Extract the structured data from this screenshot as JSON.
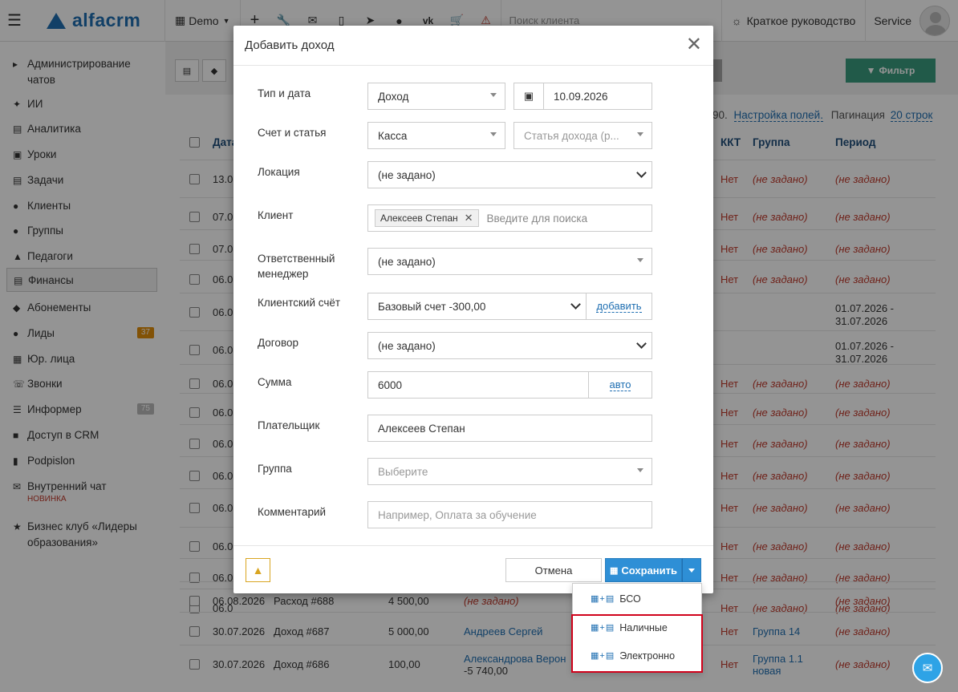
{
  "topbar": {
    "logo": "alfacrm",
    "demo": "Demo",
    "search_placeholder": "Поиск клиента",
    "guide": "Краткое руководство",
    "user": "Service"
  },
  "sidebar": {
    "items": [
      {
        "label": "Администрирование чатов",
        "icon": "chat-admin-icon"
      },
      {
        "label": "ИИ",
        "icon": "sparkles-icon"
      },
      {
        "label": "Аналитика",
        "icon": "chart-icon"
      },
      {
        "label": "Уроки",
        "icon": "calendar-icon"
      },
      {
        "label": "Задачи",
        "icon": "clipboard-icon"
      },
      {
        "label": "Клиенты",
        "icon": "user-icon"
      },
      {
        "label": "Группы",
        "icon": "users-icon"
      },
      {
        "label": "Педагоги",
        "icon": "graduation-cap-icon"
      },
      {
        "label": "Финансы",
        "icon": "money-icon"
      },
      {
        "label": "Абонементы",
        "icon": "tag-icon"
      },
      {
        "label": "Лиды",
        "icon": "user-plus-icon",
        "badge": "37"
      },
      {
        "label": "Юр. лица",
        "icon": "building-icon"
      },
      {
        "label": "Звонки",
        "icon": "phone-icon"
      },
      {
        "label": "Информер",
        "icon": "list-icon",
        "badge": "75"
      },
      {
        "label": "Доступ в CRM",
        "icon": "lock-icon"
      },
      {
        "label": "Podpislon",
        "icon": "document-icon"
      },
      {
        "label": "Внутренний чат",
        "icon": "envelope-icon",
        "note": "НОВИНКА"
      },
      {
        "label": "Бизнес клуб «Лидеры образования»",
        "icon": "star-icon"
      }
    ]
  },
  "main": {
    "filter_label": "Фильтр",
    "pagination_prefix": "90.",
    "settings_link": "Настройка полей.",
    "pagination_label": "Пагинация",
    "pagination_value": "20 строк",
    "columns": {
      "date": "Дата",
      "kkt": "ККТ",
      "group": "Группа",
      "period": "Период"
    },
    "rows": [
      {
        "date": "13.0",
        "kkt": "Нет",
        "group": "(не задано)",
        "period": "(не задано)"
      },
      {
        "date": "07.0",
        "kkt": "Нет",
        "group": "(не задано)",
        "period": "(не задано)"
      },
      {
        "date": "07.0",
        "kkt": "Нет",
        "group": "(не задано)",
        "period": "(не задано)"
      },
      {
        "date": "06.0",
        "kkt": "Нет",
        "group": "(не задано)",
        "period": "(не задано)"
      },
      {
        "date": "06.0",
        "kkt": "",
        "group": "",
        "period": "01.07.2026 - 31.07.2026"
      },
      {
        "date": "06.0",
        "kkt": "",
        "group": "",
        "period": "01.07.2026 - 31.07.2026"
      },
      {
        "date": "06.0",
        "kkt": "Нет",
        "group": "(не задано)",
        "period": "(не задано)"
      },
      {
        "date": "06.0",
        "kkt": "Нет",
        "group": "(не задано)",
        "period": "(не задано)"
      },
      {
        "date": "06.0",
        "kkt": "Нет",
        "group": "(не задано)",
        "period": "(не задано)"
      },
      {
        "date": "06.0",
        "kkt": "Нет",
        "group": "(не задано)",
        "period": "(не задано)"
      },
      {
        "date": "06.0",
        "kkt": "Нет",
        "group": "(не задано)",
        "period": "(не задано)"
      },
      {
        "date": "06.0",
        "kkt": "Нет",
        "group": "(не задано)",
        "period": "(не задано)"
      },
      {
        "date": "06.0",
        "kkt": "Нет",
        "group": "(не задано)",
        "period": "(не задано)"
      },
      {
        "date": "06.0",
        "kkt": "Нет",
        "group": "(не задано)",
        "period": "(не задано)"
      }
    ],
    "bottom_rows": [
      {
        "date": "06.08.2026",
        "doc": "Расход #688",
        "amount": "4 500,00",
        "client": "(не задано)",
        "kkt": "",
        "group": "",
        "period": "(не задано)"
      },
      {
        "date": "30.07.2026",
        "doc": "Доход #687",
        "amount": "5 000,00",
        "client": "Андреев Сергей",
        "kkt": "Нет",
        "group": "Группа 14",
        "period": "(не задано)"
      },
      {
        "date": "30.07.2026",
        "doc": "Доход #686",
        "amount": "100,00",
        "client": "Александрова Верон",
        "client_sub": "-5 740,00",
        "kkt": "Нет",
        "group": "Группа 1.1 новая",
        "period": "(не задано)"
      }
    ]
  },
  "modal": {
    "title": "Добавить доход",
    "fields": {
      "type_date_label": "Тип и дата",
      "type_value": "Доход",
      "date_value": "10.09.2026",
      "account_label": "Счет и статья",
      "account_value": "Касса",
      "article_placeholder": "Статья дохода (р...",
      "location_label": "Локация",
      "location_value": "(не задано)",
      "client_label": "Клиент",
      "client_tag": "Алексеев Степан",
      "client_placeholder": "Введите для поиска",
      "manager_label": "Ответственный менеджер",
      "manager_value": "(не задано)",
      "client_account_label": "Клиентский счёт",
      "client_account_value": "Базовый счет -300,00",
      "add_link": "добавить",
      "contract_label": "Договор",
      "contract_value": "(не задано)",
      "sum_label": "Сумма",
      "sum_value": "6000",
      "auto_link": "авто",
      "payer_label": "Плательщик",
      "payer_value": "Алексеев Степан",
      "group_label": "Группа",
      "group_placeholder": "Выберите",
      "comment_label": "Комментарий",
      "comment_placeholder": "Например, Оплата за обучение"
    },
    "cancel_label": "Отмена",
    "save_label": "Сохранить"
  },
  "dropdown": {
    "items": [
      {
        "label": "БСО",
        "icon": "printer-icon"
      },
      {
        "label": "Наличные",
        "icon": "cash-icon"
      },
      {
        "label": "Электронно",
        "icon": "card-icon"
      }
    ]
  },
  "colors": {
    "brand": "#1f6fb2",
    "primary_button": "#2e8fd6",
    "filter_button": "#3a9c7e",
    "badge_orange": "#e08e0b",
    "badge_gray": "#999999",
    "highlight": "#d0021b",
    "negative": "#c0392b"
  }
}
